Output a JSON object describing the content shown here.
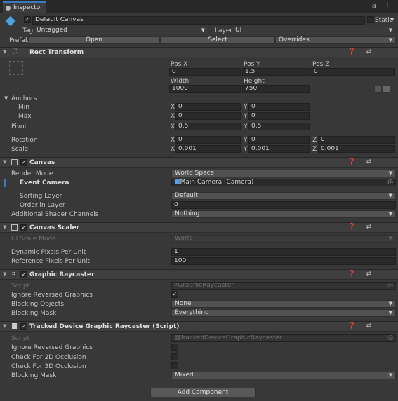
{
  "tab": {
    "label": "Inspector",
    "right_icons": "a ⋮"
  },
  "object": {
    "name": "Default Canvas",
    "static_label": "Static",
    "tag_label": "Tag",
    "tag_value": "Untagged",
    "layer_label": "Layer",
    "layer_value": "UI",
    "prefab_label": "Prefab",
    "prefab_open": "Open",
    "prefab_select": "Select",
    "prefab_overrides": "Overrides"
  },
  "rect_transform": {
    "title": "Rect Transform",
    "pos_x_label": "Pos X",
    "pos_y_label": "Pos Y",
    "pos_z_label": "Pos Z",
    "pos_x": "0",
    "pos_y": "1.5",
    "pos_z": "0",
    "width_label": "Width",
    "height_label": "Height",
    "width": "1000",
    "height": "750",
    "anchors_label": "Anchors",
    "min_label": "Min",
    "max_label": "Max",
    "min_x": "0",
    "min_y": "0",
    "max_x": "0",
    "max_y": "0",
    "pivot_label": "Pivot",
    "pivot_x": "0.5",
    "pivot_y": "0.5",
    "rotation_label": "Rotation",
    "rot_x": "0",
    "rot_y": "0",
    "rot_z": "0",
    "scale_label": "Scale",
    "scale_x": "0.001",
    "scale_y": "0.001",
    "scale_z": "0.001",
    "axis_x": "X",
    "axis_y": "Y",
    "axis_z": "Z"
  },
  "canvas": {
    "title": "Canvas",
    "render_mode_label": "Render Mode",
    "render_mode": "World Space",
    "event_camera_label": "Event Camera",
    "event_camera": "Main Camera (Camera)",
    "sorting_layer_label": "Sorting Layer",
    "sorting_layer": "Default",
    "order_label": "Order in Layer",
    "order": "0",
    "shader_label": "Additional Shader Channels",
    "shader": "Nothing"
  },
  "canvas_scaler": {
    "title": "Canvas Scaler",
    "ui_scale_label": "UI Scale Mode",
    "ui_scale": "World",
    "dpu_label": "Dynamic Pixels Per Unit",
    "dpu": "1",
    "rpu_label": "Reference Pixels Per Unit",
    "rpu": "100"
  },
  "graphic_raycaster": {
    "title": "Graphic Raycaster",
    "script_label": "Script",
    "script": "GraphicRaycaster",
    "ignore_label": "Ignore Reversed Graphics",
    "blocking_objects_label": "Blocking Objects",
    "blocking_objects": "None",
    "blocking_mask_label": "Blocking Mask",
    "blocking_mask": "Everything"
  },
  "tracked_raycaster": {
    "title": "Tracked Device Graphic Raycaster (Script)",
    "script_label": "Script",
    "script": "TrackedDeviceGraphicRaycaster",
    "ignore_label": "Ignore Reversed Graphics",
    "check2d_label": "Check For 2D Occlusion",
    "check3d_label": "Check For 3D Occlusion",
    "blocking_mask_label": "Blocking Mask",
    "blocking_mask": "Mixed..."
  },
  "add_component": "Add Component",
  "header_icons": "❓ ⇄ ⋮"
}
